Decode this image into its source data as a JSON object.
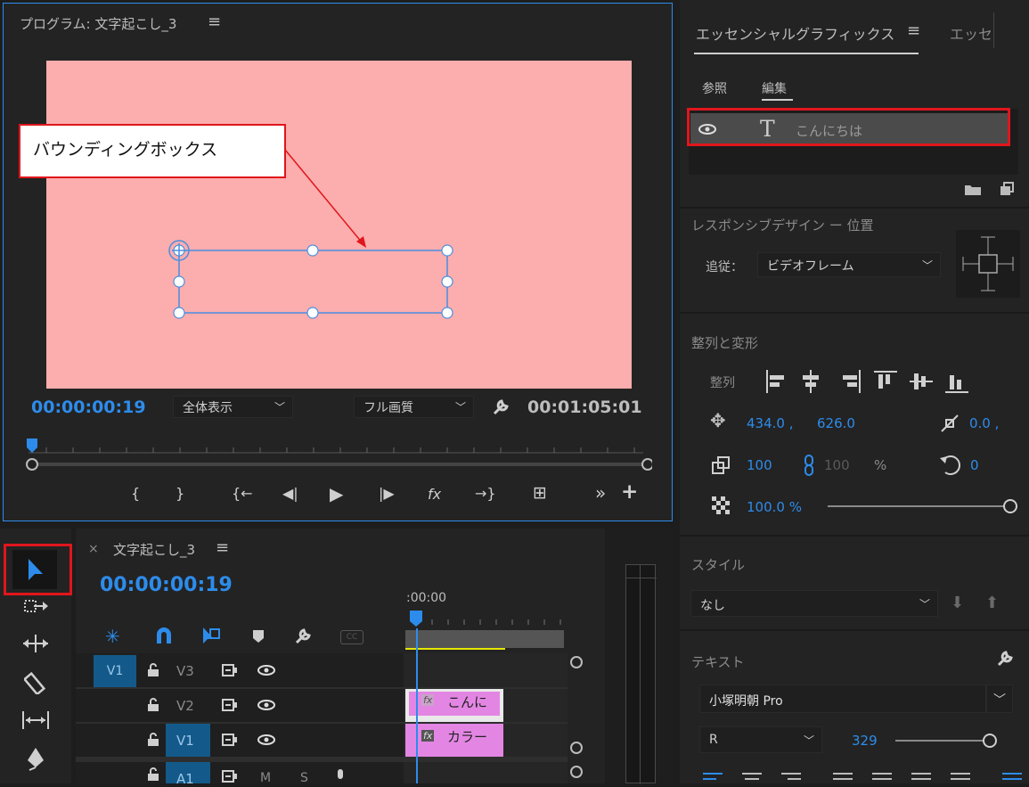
{
  "monitor": {
    "title": "プログラム: 文字起こし_3",
    "menu_icon": "≡",
    "timecode_current": "00:00:00:19",
    "timecode_duration": "00:01:05:01",
    "zoom_select": "全体表示",
    "quality_select": "フル画質",
    "annotation_label": "バウンディングボックス"
  },
  "transport": {
    "mark_in": "{",
    "mark_out": "}",
    "go_to_in": "{←",
    "step_back": "◀|",
    "play": "▶",
    "step_forward": "|▶",
    "fx": "fx",
    "go_to_out": "→}",
    "export_frame": "⊞",
    "more": "»",
    "add": "+"
  },
  "essential_graphics": {
    "tabs": [
      "エッセンシャルグラフィックス",
      "エッセ"
    ],
    "subtabs": [
      "参照",
      "編集"
    ],
    "layer_name": "こんにちは",
    "responsive_label": "レスポンシブデザイン ー 位置",
    "follow_label": "追従：",
    "follow_value": "ビデオフレーム",
    "align_transform_label": "整列と変形",
    "align_label": "整列",
    "position_x": "434.0 ,",
    "position_y": "626.0",
    "anchor_value": "0.0 ,",
    "scale": "100",
    "scale_linked": "100",
    "percent": "%",
    "rotation": "0",
    "opacity": "100.0 %",
    "style_label": "スタイル",
    "style_value": "なし",
    "text_label": "テキスト",
    "font_family": "小塚明朝 Pro",
    "font_weight": "R",
    "font_size": "329"
  },
  "timeline": {
    "title": "文字起こし_3",
    "close": "×",
    "menu_icon": "≡",
    "timecode": "00:00:00:19",
    "ruler_label": ":00:00",
    "tracks": [
      {
        "source": "V1",
        "name": "V3",
        "clip": ""
      },
      {
        "source": "",
        "name": "V2",
        "clip": "こんに"
      },
      {
        "source": "",
        "name": "V1",
        "clip": "カラー"
      },
      {
        "source": "",
        "name": "A1",
        "clip": ""
      }
    ],
    "track_mute": "M",
    "track_solo": "S",
    "clip_fx": "fx",
    "cc_label": "CC"
  },
  "colors": {
    "accent": "#2d8ceb",
    "frame": "#fcadad",
    "highlight_box": "#e0161c",
    "clip": "#e386e3"
  }
}
